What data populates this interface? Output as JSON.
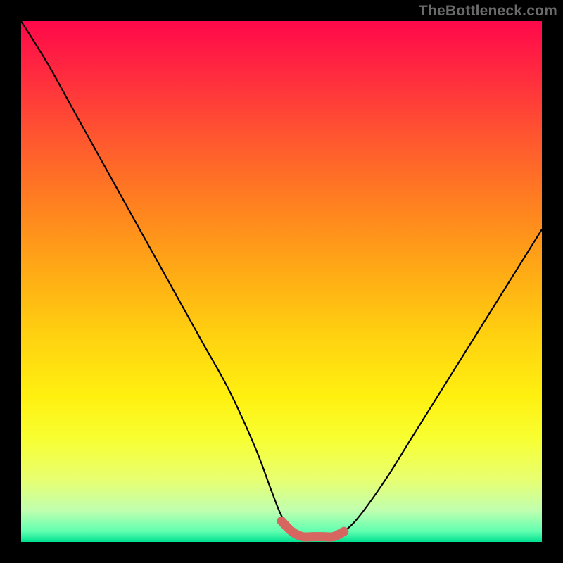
{
  "watermark": "TheBottleneck.com",
  "chart_data": {
    "type": "line",
    "title": "",
    "xlabel": "",
    "ylabel": "",
    "xlim": [
      0,
      100
    ],
    "ylim": [
      0,
      100
    ],
    "grid": false,
    "legend": false,
    "series": [
      {
        "name": "curve",
        "color": "#000000",
        "x": [
          0,
          5,
          10,
          15,
          20,
          25,
          30,
          35,
          40,
          45,
          48,
          50,
          52,
          54,
          56,
          58,
          60,
          62,
          65,
          70,
          75,
          80,
          85,
          90,
          95,
          100
        ],
        "values": [
          100,
          92,
          83,
          74,
          65,
          56,
          47,
          38,
          29,
          18,
          10,
          5,
          2,
          1,
          1,
          1,
          1,
          2,
          5,
          12,
          20,
          28,
          36,
          44,
          52,
          60
        ]
      },
      {
        "name": "bottom-highlight",
        "color": "#d6665f",
        "x": [
          50,
          52,
          54,
          56,
          58,
          60,
          62
        ],
        "values": [
          4,
          2,
          1,
          1,
          1,
          1,
          2
        ]
      }
    ]
  }
}
